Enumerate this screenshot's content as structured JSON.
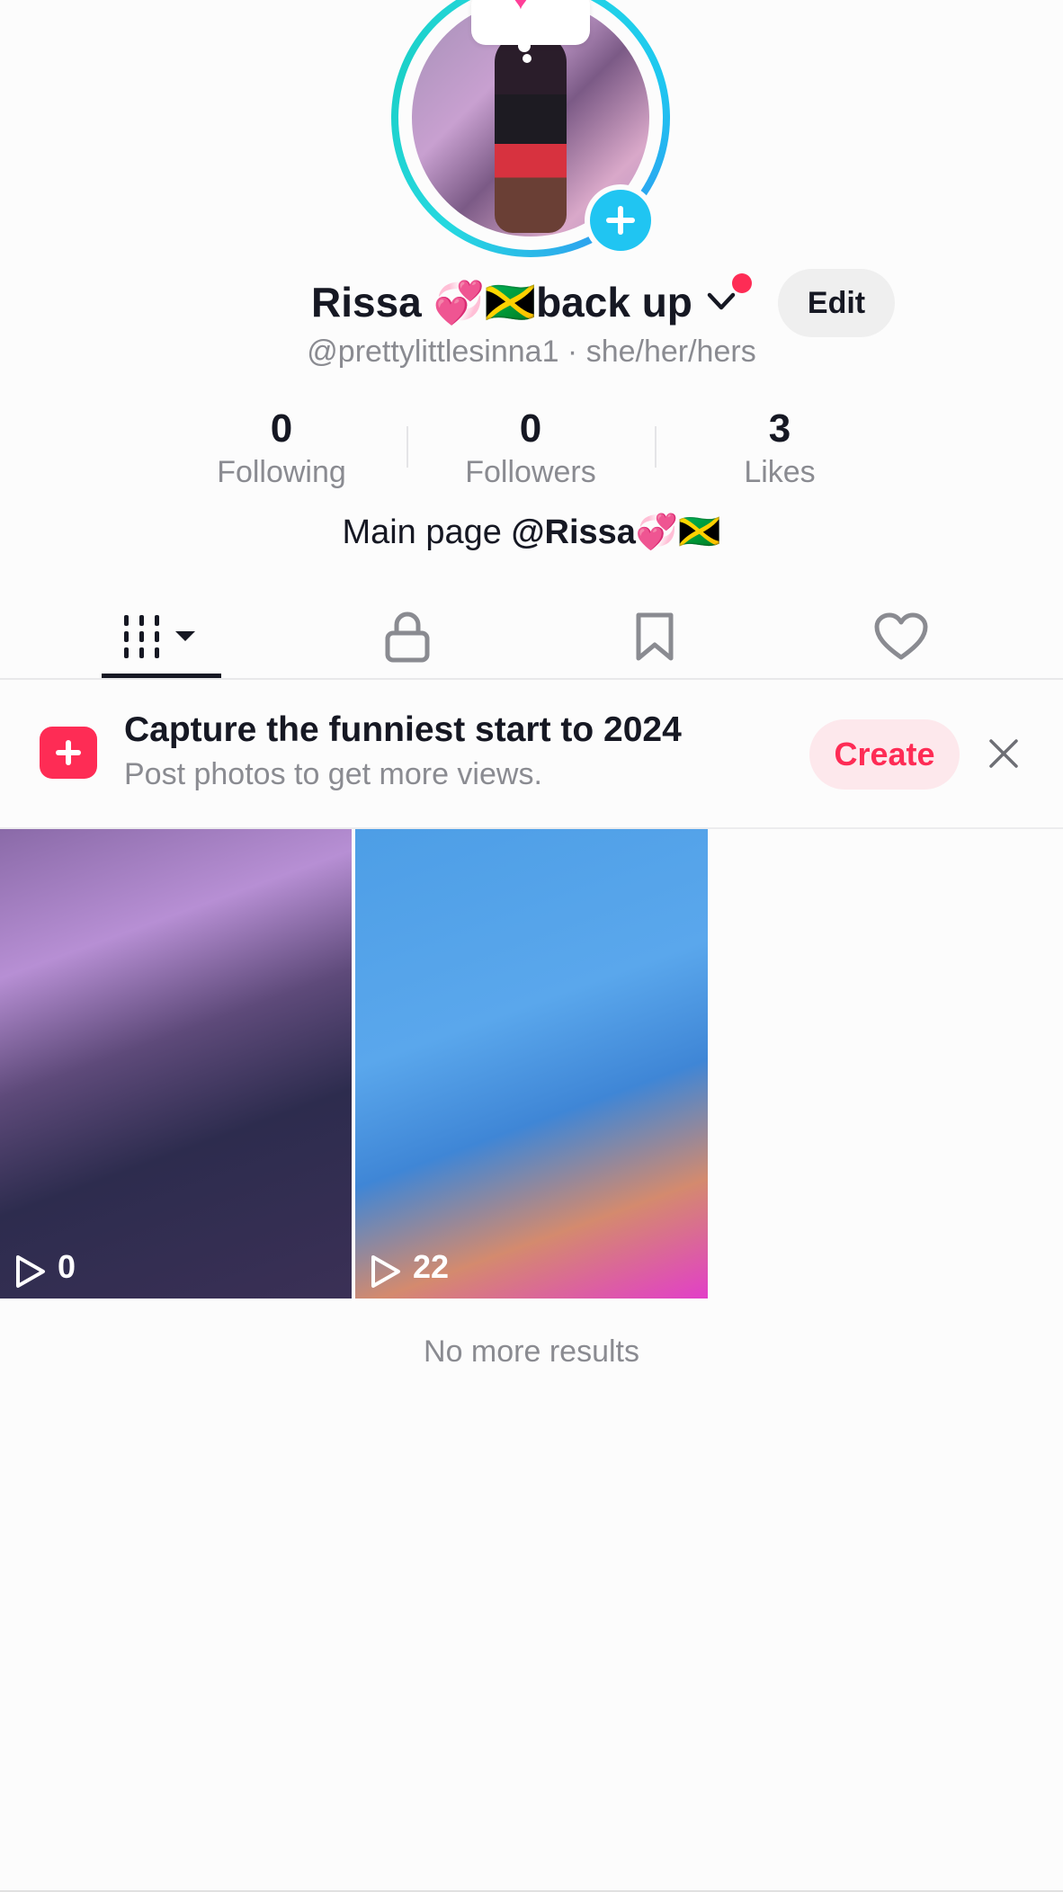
{
  "profile": {
    "display_name": "Rissa 💞🇯🇲back up",
    "edit_label": "Edit",
    "handle_line": "@prettylittlesinna1 · she/her/hers",
    "bio_prefix": "Main page ",
    "bio_mention": "@Rissa💞🇯🇲"
  },
  "stats": [
    {
      "value": "0",
      "label": "Following"
    },
    {
      "value": "0",
      "label": "Followers"
    },
    {
      "value": "3",
      "label": "Likes"
    }
  ],
  "tabs": [
    {
      "icon": "grid-icon",
      "active": true
    },
    {
      "icon": "lock-icon",
      "active": false
    },
    {
      "icon": "bookmark-icon",
      "active": false
    },
    {
      "icon": "heart-icon",
      "active": false
    }
  ],
  "promo": {
    "title": "Capture the funniest start to 2024",
    "subtitle": "Post photos to get more views.",
    "create_label": "Create"
  },
  "videos": [
    {
      "views": "0"
    },
    {
      "views": "22"
    }
  ],
  "footer": {
    "no_more": "No more results"
  },
  "colors": {
    "accent": "#fe2c55",
    "avatar_ring": "#25d8e0",
    "add_button": "#20c5f2"
  }
}
